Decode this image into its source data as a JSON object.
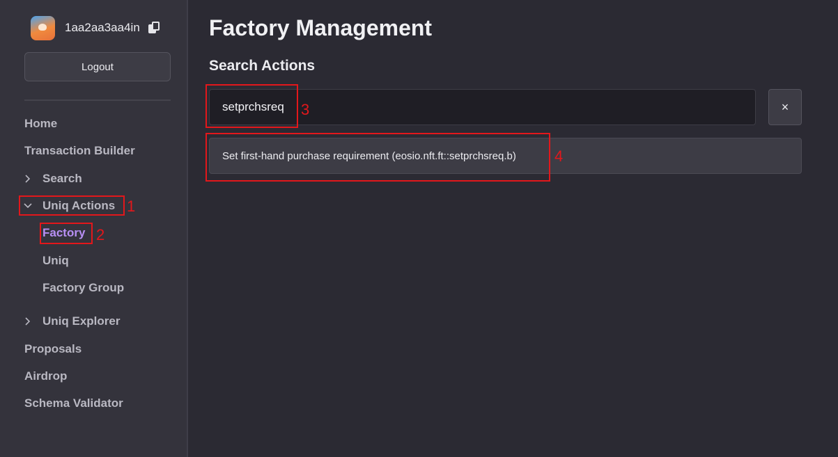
{
  "user": {
    "name": "1aa2aa3aa4in",
    "avatar_icon": "avatar-icon",
    "copy_icon": "copy-icon"
  },
  "sidebar": {
    "logout_label": "Logout",
    "items": [
      {
        "label": "Home"
      },
      {
        "label": "Transaction Builder"
      },
      {
        "label": "Search",
        "chevron": "chevron-right-icon"
      },
      {
        "label": "Uniq Actions",
        "chevron": "chevron-down-icon",
        "expanded": true
      },
      {
        "label": "Factory",
        "active": true
      },
      {
        "label": "Uniq"
      },
      {
        "label": "Factory Group"
      },
      {
        "label": "Uniq Explorer",
        "chevron": "chevron-right-icon"
      },
      {
        "label": "Proposals"
      },
      {
        "label": "Airdrop"
      },
      {
        "label": "Schema Validator"
      }
    ]
  },
  "main": {
    "title": "Factory Management",
    "section_title": "Search Actions",
    "search_value": "setprchsreq",
    "clear_label": "×",
    "results": [
      {
        "label": "Set first-hand purchase requirement (eosio.nft.ft::setprchsreq.b)"
      }
    ]
  },
  "annotations": [
    "1",
    "2",
    "3",
    "4"
  ],
  "colors": {
    "accent": "#b78ff4",
    "annotation": "#e3171b",
    "background": "#2b2a33",
    "sidebar": "#34333c"
  }
}
